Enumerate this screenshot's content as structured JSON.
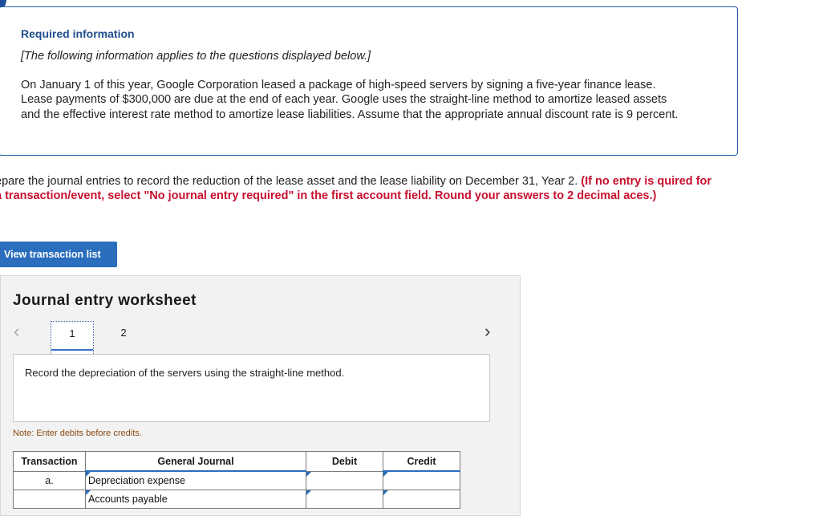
{
  "info": {
    "title": "Required information",
    "subtitle": "[The following information applies to the questions displayed below.]",
    "body": "On January 1 of this year, Google Corporation leased a package of high-speed servers by signing a five-year finance lease. Lease payments of $300,000 are due at the end of each year. Google uses the straight-line method to amortize leased assets and the effective interest rate method to amortize lease liabilities. Assume that the appropriate annual discount rate is 9 percent."
  },
  "instructions": {
    "main": "epare the journal entries to record the reduction of the lease asset and the lease liability on December 31, Year 2. ",
    "emphasis": "(If no entry is quired for a transaction/event, select \"No journal entry required\" in the first account field. Round your answers to 2 decimal aces.)"
  },
  "view_button_label": "View transaction list",
  "worksheet": {
    "title": "Journal entry worksheet",
    "tabs": [
      "1",
      "2"
    ],
    "prompt": "Record the depreciation of the servers using the straight-line method.",
    "note": "Note: Enter debits before credits.",
    "columns": [
      "Transaction",
      "General Journal",
      "Debit",
      "Credit"
    ],
    "rows": [
      {
        "transaction": "a.",
        "account": "Depreciation expense",
        "debit": "",
        "credit": ""
      },
      {
        "transaction": "",
        "account": "Accounts payable",
        "debit": "",
        "credit": ""
      }
    ]
  },
  "colors": {
    "accent": "#2a6ebd",
    "title_blue": "#1f4f8f",
    "emphasis_red": "#c8102e"
  }
}
